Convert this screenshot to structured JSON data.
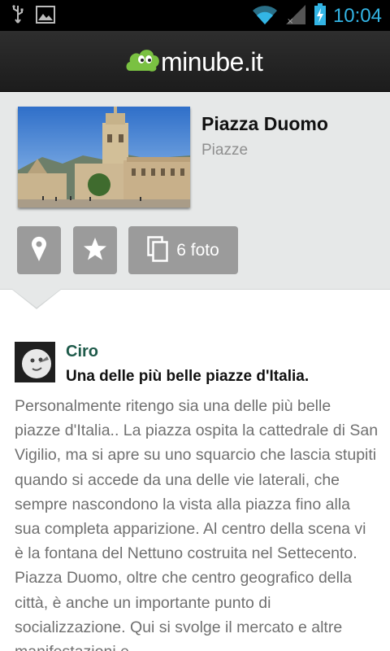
{
  "status_bar": {
    "time": "10:04",
    "icons": [
      "usb-icon",
      "image-icon",
      "wifi-icon",
      "signal-icon",
      "battery-charging-icon"
    ],
    "accent_color": "#33b5e5"
  },
  "header": {
    "brand": "minube.it",
    "logo_color": "#7ac142"
  },
  "place": {
    "name": "Piazza Duomo",
    "category": "Piazze",
    "actions": {
      "map_icon": "map-pin-icon",
      "favorite_icon": "star-icon",
      "photos_label": "6 foto",
      "photos_icon": "photos-icon"
    }
  },
  "review": {
    "author": "Ciro",
    "title": "Una delle più belle piazze d'Italia.",
    "body": "Personalmente ritengo sia una delle più belle piazze d'Italia.. La piazza ospita la cattedrale di San Vigilio, ma si apre su uno squarcio che lascia stupiti quando si accede da una delle vie laterali, che sempre nascondono la vista alla piazza fino alla sua completa apparizione. Al centro della scena vi è la fontana del Nettuno costruita nel Settecento. Piazza Duomo, oltre che centro geografico della città, è anche un importante punto di socializzazione. Qui si svolge il mercato e altre manifestazioni e"
  }
}
